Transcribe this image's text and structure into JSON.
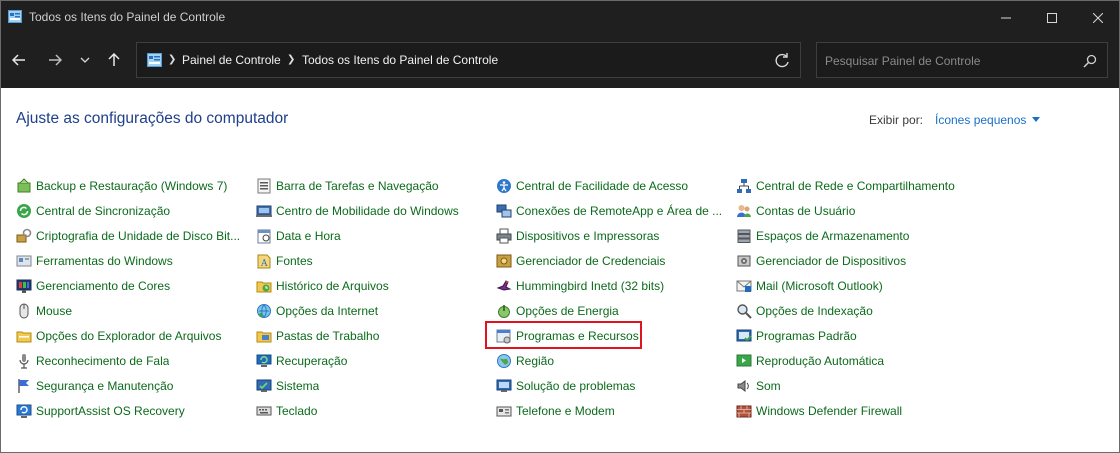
{
  "window": {
    "title": "Todos os Itens do Painel de Controle"
  },
  "address": {
    "breadcrumbs": [
      "Painel de Controle",
      "Todos os Itens do Painel de Controle"
    ]
  },
  "search": {
    "placeholder": "Pesquisar Painel de Controle"
  },
  "content": {
    "title": "Ajuste as configurações do computador",
    "view_label": "Exibir por:",
    "view_value": "Ícones pequenos"
  },
  "columns": [
    [
      {
        "label": "Backup e Restauração (Windows 7)",
        "icon": "backup-icon"
      },
      {
        "label": "Central de Sincronização",
        "icon": "sync-icon"
      },
      {
        "label": "Criptografia de Unidade de Disco Bit...",
        "icon": "bitlocker-icon"
      },
      {
        "label": "Ferramentas do Windows",
        "icon": "tools-icon"
      },
      {
        "label": "Gerenciamento de Cores",
        "icon": "color-icon"
      },
      {
        "label": "Mouse",
        "icon": "mouse-icon"
      },
      {
        "label": "Opções do Explorador de Arquivos",
        "icon": "folder-options-icon"
      },
      {
        "label": "Reconhecimento de Fala",
        "icon": "microphone-icon"
      },
      {
        "label": "Segurança e Manutenção",
        "icon": "flag-icon"
      },
      {
        "label": "SupportAssist OS Recovery",
        "icon": "recovery-icon"
      }
    ],
    [
      {
        "label": "Barra de Tarefas e Navegação",
        "icon": "taskbar-icon"
      },
      {
        "label": "Centro de Mobilidade do Windows",
        "icon": "mobility-icon"
      },
      {
        "label": "Data e Hora",
        "icon": "calendar-icon"
      },
      {
        "label": "Fontes",
        "icon": "fonts-icon"
      },
      {
        "label": "Histórico de Arquivos",
        "icon": "file-history-icon"
      },
      {
        "label": "Opções da Internet",
        "icon": "internet-icon"
      },
      {
        "label": "Pastas de Trabalho",
        "icon": "work-folders-icon"
      },
      {
        "label": "Recuperação",
        "icon": "recovery-pc-icon"
      },
      {
        "label": "Sistema",
        "icon": "system-icon"
      },
      {
        "label": "Teclado",
        "icon": "keyboard-icon"
      }
    ],
    [
      {
        "label": "Central de Facilidade de Acesso",
        "icon": "accessibility-icon"
      },
      {
        "label": "Conexões de RemoteApp e Área de ...",
        "icon": "remoteapp-icon"
      },
      {
        "label": "Dispositivos e Impressoras",
        "icon": "printer-icon"
      },
      {
        "label": "Gerenciador de Credenciais",
        "icon": "credentials-icon"
      },
      {
        "label": "Hummingbird Inetd (32 bits)",
        "icon": "hummingbird-icon"
      },
      {
        "label": "Opções de Energia",
        "icon": "power-icon"
      },
      {
        "label": "Programas e Recursos",
        "icon": "programs-icon"
      },
      {
        "label": "Região",
        "icon": "region-icon"
      },
      {
        "label": "Solução de problemas",
        "icon": "troubleshoot-icon"
      },
      {
        "label": "Telefone e Modem",
        "icon": "phone-icon"
      }
    ],
    [
      {
        "label": "Central de Rede e Compartilhamento",
        "icon": "network-icon"
      },
      {
        "label": "Contas de Usuário",
        "icon": "users-icon"
      },
      {
        "label": "Espaços de Armazenamento",
        "icon": "storage-icon"
      },
      {
        "label": "Gerenciador de Dispositivos",
        "icon": "device-manager-icon"
      },
      {
        "label": "Mail (Microsoft Outlook)",
        "icon": "mail-icon"
      },
      {
        "label": "Opções de Indexação",
        "icon": "indexing-icon"
      },
      {
        "label": "Programas Padrão",
        "icon": "default-programs-icon"
      },
      {
        "label": "Reprodução Automática",
        "icon": "autoplay-icon"
      },
      {
        "label": "Som",
        "icon": "sound-icon"
      },
      {
        "label": "Windows Defender Firewall",
        "icon": "firewall-icon"
      }
    ]
  ]
}
